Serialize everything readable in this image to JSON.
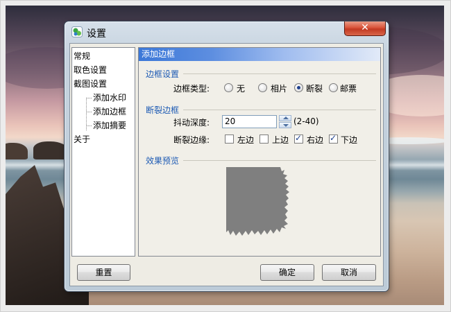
{
  "window": {
    "title": "设置",
    "close_glyph": "✕"
  },
  "nav": {
    "items": [
      {
        "label": "常规"
      },
      {
        "label": "取色设置"
      },
      {
        "label": "截图设置"
      },
      {
        "label": "添加水印"
      },
      {
        "label": "添加边框"
      },
      {
        "label": "添加摘要"
      },
      {
        "label": "关于"
      }
    ]
  },
  "panel": {
    "header": "添加边框",
    "border_settings": {
      "title": "边框设置",
      "type_label": "边框类型:",
      "options": [
        {
          "label": "无",
          "checked": false
        },
        {
          "label": "相片",
          "checked": false
        },
        {
          "label": "断裂",
          "checked": true
        },
        {
          "label": "邮票",
          "checked": false
        }
      ]
    },
    "torn_border": {
      "title": "断裂边框",
      "jitter_label": "抖动深度:",
      "jitter_value": "20",
      "jitter_range": "(2-40)",
      "edges_label": "断裂边缘:",
      "edges": [
        {
          "label": "左边",
          "checked": false
        },
        {
          "label": "上边",
          "checked": false
        },
        {
          "label": "右边",
          "checked": true
        },
        {
          "label": "下边",
          "checked": true
        }
      ]
    },
    "preview": {
      "title": "效果预览"
    }
  },
  "buttons": {
    "reset": "重置",
    "ok": "确定",
    "cancel": "取消"
  },
  "colors": {
    "header_blue": "#3c78d8",
    "group_title_blue": "#1e5bb4",
    "preview_gray": "#7f7f7f",
    "close_red": "#c33a22"
  },
  "icons": {
    "app": "app-icon",
    "close": "close-icon",
    "spin_up": "spin-up-icon",
    "spin_down": "spin-down-icon"
  }
}
